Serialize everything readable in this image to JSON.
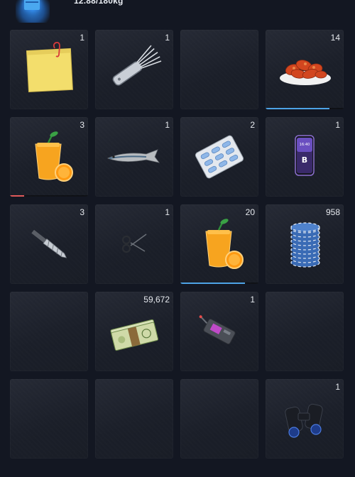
{
  "header": {
    "weight_text": "12.88/180kg",
    "badge_icon": "box-icon",
    "accent": "#3a98ff"
  },
  "colors": {
    "slot_bg": "#1f232d",
    "bar_blue": "#4da3e6",
    "bar_red": "#e05a5a"
  },
  "inventory": {
    "slots": [
      {
        "item": "sticky-note",
        "qty": "1"
      },
      {
        "item": "lockpick-set",
        "qty": "1"
      },
      {
        "item": "empty",
        "qty": ""
      },
      {
        "item": "chicken-wings",
        "qty": "14",
        "durability": 0.82,
        "bar_color": "blue"
      },
      {
        "item": "orange-juice",
        "qty": "3",
        "durability": 0.18,
        "bar_color": "red"
      },
      {
        "item": "sardine",
        "qty": "1"
      },
      {
        "item": "pill-pack",
        "qty": "2"
      },
      {
        "item": "smartphone",
        "qty": "1"
      },
      {
        "item": "drill-bit",
        "qty": "3"
      },
      {
        "item": "scissors",
        "qty": "1"
      },
      {
        "item": "orange-juice",
        "qty": "20",
        "durability": 0.83,
        "bar_color": "blue"
      },
      {
        "item": "casino-chips",
        "qty": "958"
      },
      {
        "item": "empty",
        "qty": ""
      },
      {
        "item": "cash-stack",
        "qty": "59,672"
      },
      {
        "item": "hacking-device",
        "qty": "1"
      },
      {
        "item": "empty",
        "qty": ""
      },
      {
        "item": "empty",
        "qty": ""
      },
      {
        "item": "empty",
        "qty": ""
      },
      {
        "item": "empty",
        "qty": ""
      },
      {
        "item": "binoculars",
        "qty": "1"
      }
    ]
  },
  "phone_screen": {
    "time": "16:40"
  }
}
